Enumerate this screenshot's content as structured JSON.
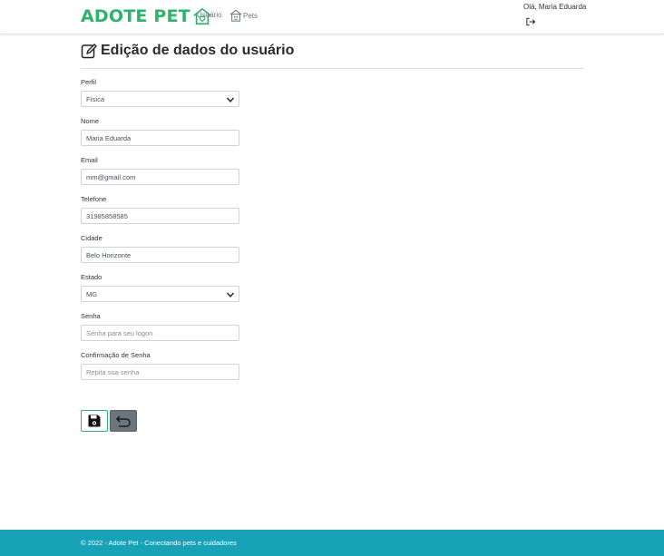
{
  "navbar": {
    "brand": "ADOTE PET",
    "links": [
      {
        "label": "Usuário"
      },
      {
        "label": "Pets"
      }
    ],
    "greeting": "Olá, Maria Eduarda"
  },
  "page": {
    "title": "Edição de dados do usuário"
  },
  "form": {
    "perfil": {
      "label": "Perfil",
      "value": "Física"
    },
    "nome": {
      "label": "Nome",
      "value": "Maria Eduarda"
    },
    "email": {
      "label": "Email",
      "value": "mm@gmail.com"
    },
    "telefone": {
      "label": "Telefone",
      "value": "31985858585"
    },
    "cidade": {
      "label": "Cidade",
      "value": "Belo Horizonte"
    },
    "estado": {
      "label": "Estado",
      "value": "MG"
    },
    "senha": {
      "label": "Senha",
      "placeholder": "Senha para seu logon"
    },
    "confirmacao": {
      "label": "Confirmação de Senha",
      "placeholder": "Repita sua senha"
    }
  },
  "footer": {
    "text": "© 2022 - Adote Pet - Conectando pets e cuidadores"
  },
  "colors": {
    "brand": "#2fb36b",
    "footer": "#17a2b8",
    "secondary": "#6c757d"
  }
}
